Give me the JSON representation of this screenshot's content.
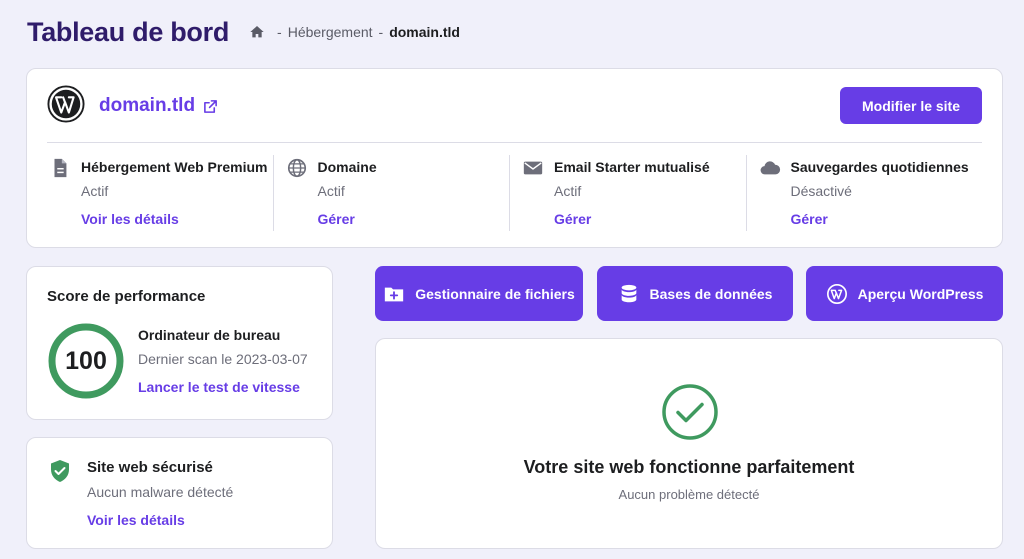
{
  "header": {
    "title": "Tableau de bord",
    "breadcrumb": {
      "separator": "-",
      "parent": "Hébergement",
      "current": "domain.tld"
    }
  },
  "site": {
    "name": "domain.tld",
    "edit_label": "Modifier le site"
  },
  "services": [
    {
      "icon": "document-icon",
      "title": "Hébergement Web Premium",
      "status": "Actif",
      "link": "Voir les détails"
    },
    {
      "icon": "globe-icon",
      "title": "Domaine",
      "status": "Actif",
      "link": "Gérer"
    },
    {
      "icon": "mail-icon",
      "title": "Email Starter mutualisé",
      "status": "Actif",
      "link": "Gérer"
    },
    {
      "icon": "cloud-icon",
      "title": "Sauvegardes quotidiennes",
      "status": "Désactivé",
      "link": "Gérer"
    }
  ],
  "performance": {
    "title": "Score de performance",
    "score": "100",
    "device": "Ordinateur de bureau",
    "scan": "Dernier scan le 2023-03-07",
    "link": "Lancer le test de vitesse"
  },
  "security": {
    "title": "Site web sécurisé",
    "subtitle": "Aucun malware détecté",
    "link": "Voir les détails"
  },
  "quick_actions": [
    {
      "icon": "folder-plus-icon",
      "label": "Gestionnaire de fichiers"
    },
    {
      "icon": "database-icon",
      "label": "Bases de données"
    },
    {
      "icon": "wordpress-icon",
      "label": "Aperçu WordPress"
    }
  ],
  "status": {
    "title": "Votre site web fonctionne parfaitement",
    "subtitle": "Aucun problème détecté"
  },
  "colors": {
    "accent": "#673de6",
    "title": "#2f1c6a",
    "success": "#3f9a5f",
    "background": "#f0f0fa"
  }
}
